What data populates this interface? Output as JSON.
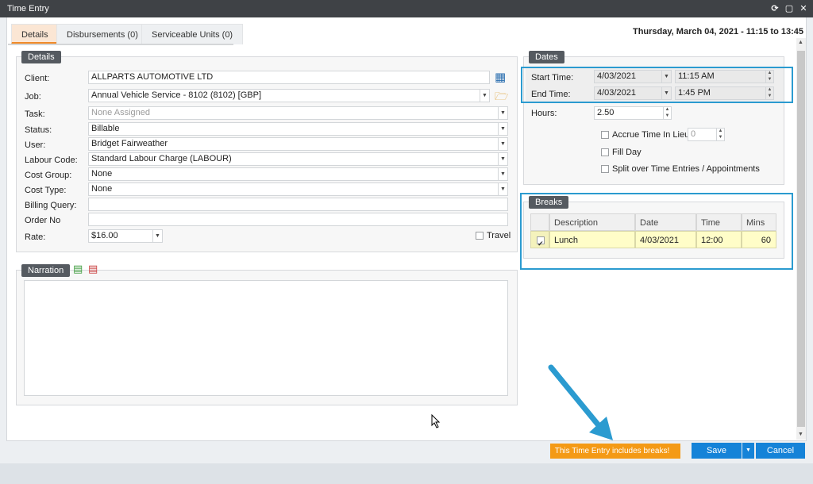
{
  "window": {
    "title": "Time Entry"
  },
  "tabs": [
    {
      "label": "Details"
    },
    {
      "label": "Disbursements (0)"
    },
    {
      "label": "Serviceable Units (0)"
    }
  ],
  "header_date": "Thursday, March 04, 2021 - 11:15 to 13:45",
  "details": {
    "section_title": "Details",
    "client_label": "Client:",
    "client_value": "ALLPARTS AUTOMOTIVE LTD",
    "job_label": "Job:",
    "job_value": "Annual Vehicle Service - 8102 (8102) [GBP]",
    "task_label": "Task:",
    "task_placeholder": "None Assigned",
    "status_label": "Status:",
    "status_value": "Billable",
    "user_label": "User:",
    "user_value": "Bridget Fairweather",
    "labour_label": "Labour Code:",
    "labour_value": "Standard Labour Charge (LABOUR)",
    "costgroup_label": "Cost Group:",
    "costgroup_value": "None",
    "costtype_label": "Cost Type:",
    "costtype_value": "None",
    "billing_label": "Billing Query:",
    "billing_value": "",
    "order_label": "Order No",
    "order_value": "",
    "rate_label": "Rate:",
    "rate_value": "$16.00",
    "travel_label": "Travel"
  },
  "narration": {
    "section_title": "Narration",
    "text": ""
  },
  "dates": {
    "section_title": "Dates",
    "start_label": "Start Time:",
    "start_date": "4/03/2021",
    "start_time": "11:15 AM",
    "end_label": "End Time:",
    "end_date": "4/03/2021",
    "end_time": "1:45 PM",
    "hours_label": "Hours:",
    "hours_value": "2.50",
    "accrue_label": "Accrue Time In Lieu",
    "accrue_value": "0",
    "fillday_label": "Fill Day",
    "split_label": "Split over Time Entries / Appointments"
  },
  "breaks": {
    "section_title": "Breaks",
    "columns": [
      "Description",
      "Date",
      "Time",
      "Mins"
    ],
    "rows": [
      {
        "description": "Lunch",
        "date": "4/03/2021",
        "time": "12:00",
        "mins": "60"
      }
    ]
  },
  "footer": {
    "notice": "This Time Entry includes breaks!",
    "save_label": "Save",
    "cancel_label": "Cancel"
  },
  "colors": {
    "accent_blue": "#2b9bd0",
    "notice_orange": "#f49a16",
    "button_blue": "#1583d8",
    "tab_active": "#f08a28"
  }
}
